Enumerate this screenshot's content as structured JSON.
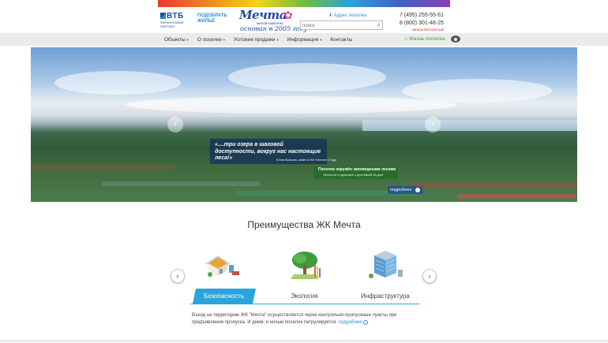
{
  "header": {
    "vtb": {
      "logo": "ВТБ",
      "subtitle": "финансовый партнер"
    },
    "pick_housing": "ПОДОБРАТЬ ЖИЛЬЕ",
    "brand": {
      "name": "Мечта",
      "type": "жилой комплекс",
      "founded": "основан в 2005 году"
    },
    "address_link": "Адрес поселка",
    "search": {
      "placeholder": "поиск"
    },
    "phones": [
      "7 (495) 255-55-61",
      "8 (800) 301-46-25"
    ],
    "phone_note": "звонок бесплатный"
  },
  "nav": {
    "items": [
      "Объекты",
      "О поселке",
      "Условия продажи",
      "Информация",
      "Контакты"
    ],
    "life_link": "Жизнь поселка"
  },
  "hero": {
    "quote": "«....три озера в шаговой доступности, вокруг нас настоящие леса!»",
    "quote_author": "Юлия Волкова, живет в ЖК «Мечта» 3 года",
    "eco_title": "Поселок окружён заповедными лесами",
    "eco_subtitle": "Экология и здоровье с доставкой на дом",
    "more_button": "подробнее"
  },
  "advantages": {
    "title": "Преимущества ЖК Мечта",
    "tabs": [
      "Безопасность",
      "Экология",
      "Инфраструктура"
    ],
    "active_tab": "Безопасность",
    "text": "Въезд на территорию ЖК \"Мечта\" осуществляется через контрольно-пропускные пункты при предъявлении пропуска. И днем, и ночью поселок патрулируется.",
    "more_link": "подробнее"
  },
  "icons": {
    "vtb": "vtb-logo-icon",
    "address": "map-pin-icon",
    "search": "search-icon",
    "life": "house-icon",
    "eye": "eye-icon",
    "arrow_left": "chevron-left-icon",
    "arrow_right": "chevron-right-icon"
  },
  "colors": {
    "accent": "#2aa5dc",
    "brand_blue": "#24489a",
    "green": "#3aa637",
    "nav_bg": "#ebebeb"
  }
}
